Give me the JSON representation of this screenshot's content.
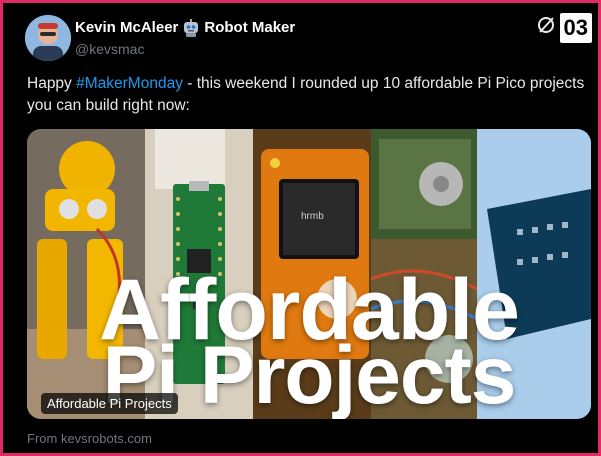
{
  "author": {
    "name": "Kevin McAleer",
    "name_suffix": "Robot Maker",
    "handle": "@kevsmac",
    "emoji_icon": "robot-emoji"
  },
  "corner": {
    "badge": "03",
    "icon": "grok-slash-icon"
  },
  "tweet": {
    "text_before": "Happy ",
    "hashtag": "#MakerMonday",
    "text_after": " - this weekend I rounded up 10 affordable Pi Pico projects you can build right now:"
  },
  "media": {
    "headline_line1": "Affordable",
    "headline_line2": "Pi Projects",
    "label": "Affordable Pi Projects",
    "screen_text": "hrmb"
  },
  "source": "From kevsrobots.com",
  "colors": {
    "frame": "#e02a66",
    "background": "#000000",
    "hashtag": "#1d9bf0",
    "muted": "#71767b"
  }
}
